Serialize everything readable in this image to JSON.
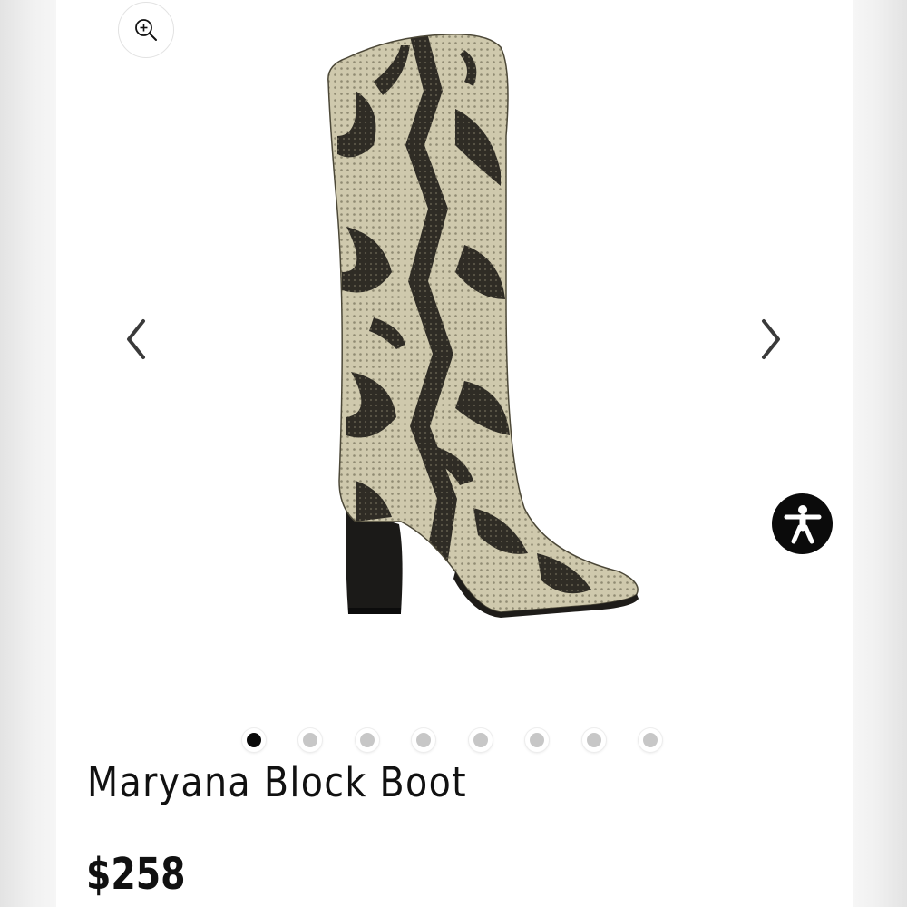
{
  "product": {
    "name": "Maryana Block Boot",
    "price": "$258",
    "image_alt": "Maryana Block Boot snake print knee-high boot"
  },
  "gallery": {
    "image_count": 8,
    "active_index": 0,
    "zoom_icon": "zoom-in-icon",
    "prev_icon": "chevron-left-icon",
    "next_icon": "chevron-right-icon"
  },
  "accessibility": {
    "icon": "accessibility-person-icon"
  },
  "colors": {
    "page_background": "#ffffff",
    "text": "#111111",
    "dot_active": "#0a0a0a",
    "dot_inactive": "#c7c7c7",
    "accessibility_button": "#0b0b0b"
  }
}
